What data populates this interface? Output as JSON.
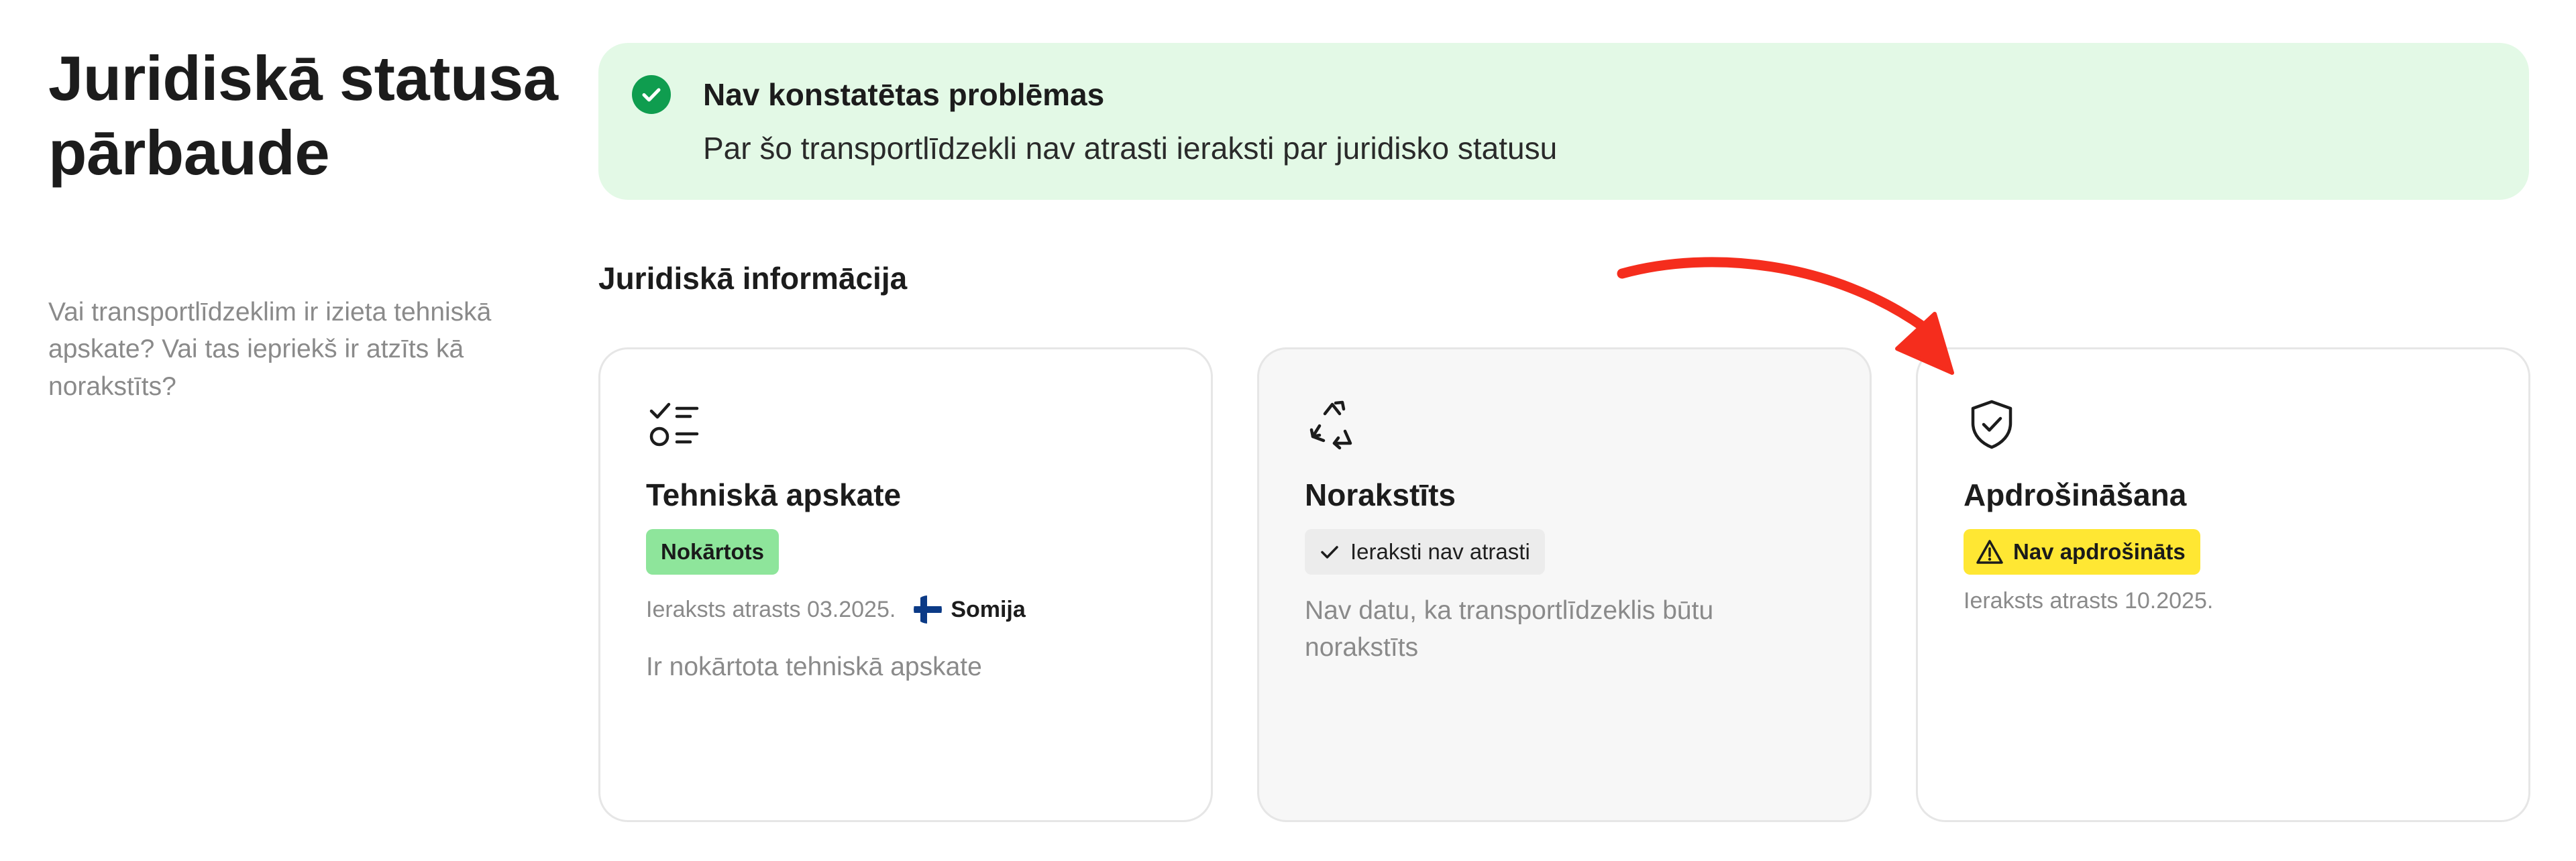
{
  "page": {
    "title": "Juridiskā statusa pārbaude",
    "subtitle": "Vai transportlīdzeklim ir izieta tehniskā apskate? Vai tas iepriekš ir atzīts kā norakstīts?"
  },
  "alert": {
    "icon": "check-circle-icon",
    "title": "Nav konstatētas problēmas",
    "text": "Par šo transportlīdzekli nav atrasti ieraksti par juridisko statusu"
  },
  "section": {
    "title": "Juridiskā informācija"
  },
  "cards": [
    {
      "icon": "checklist-icon",
      "title": "Tehniskā apskate",
      "badge": "Nokārtots",
      "meta": "Ieraksts atrasts 03.2025.",
      "country": "Somija",
      "country_icon": "finland-flag-icon",
      "description": "Ir nokārtota tehniskā apskate"
    },
    {
      "icon": "recycle-icon",
      "title": "Norakstīts",
      "badge": "Ieraksti nav atrasti",
      "badge_icon": "check-icon",
      "description": "Nav datu, ka transportlīdzeklis būtu norakstīts"
    },
    {
      "icon": "shield-check-icon",
      "title": "Apdrošināšana",
      "badge": "Nav apdrošināts",
      "badge_icon": "warning-icon",
      "meta": "Ieraksts atrasts 10.2025."
    }
  ],
  "colors": {
    "alert_background": "#e3f9e6",
    "success_green": "#0f9d4f",
    "badge_green": "#8ee59b",
    "badge_yellow": "#ffe733",
    "badge_grey": "#ececec",
    "annotation_arrow": "#f52d1d"
  }
}
